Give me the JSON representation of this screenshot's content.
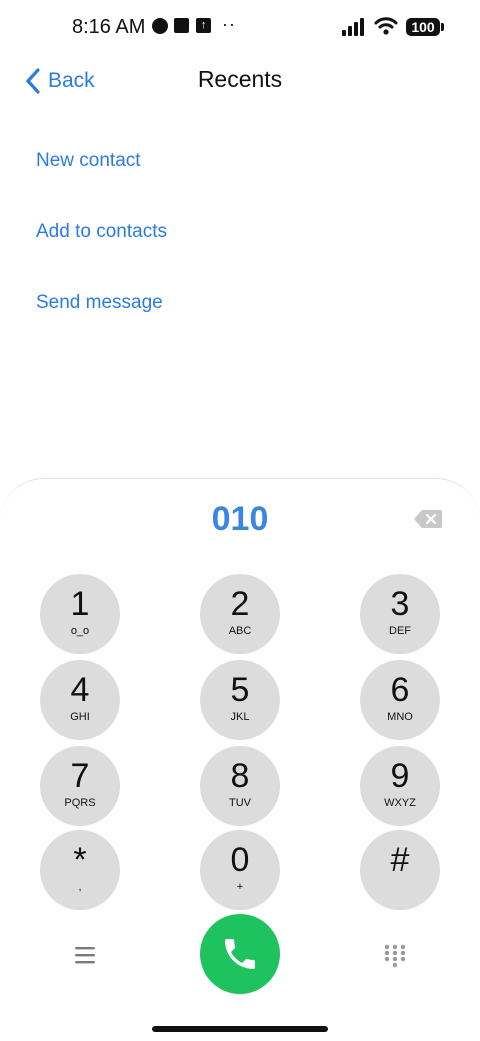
{
  "status_bar": {
    "time": "8:16 AM",
    "battery": "100",
    "icons": [
      "vpn-icon",
      "square-icon",
      "upload-icon",
      "more-dots-icon",
      "signal-icon",
      "wifi-icon",
      "battery-icon"
    ]
  },
  "header": {
    "back_label": "Back",
    "title": "Recents"
  },
  "actions": [
    {
      "label": "New contact"
    },
    {
      "label": "Add to contacts"
    },
    {
      "label": "Send message"
    }
  ],
  "dialer": {
    "number": "010",
    "keys": [
      {
        "digit": "1",
        "letters": "o_o"
      },
      {
        "digit": "2",
        "letters": "ABC"
      },
      {
        "digit": "3",
        "letters": "DEF"
      },
      {
        "digit": "4",
        "letters": "GHI"
      },
      {
        "digit": "5",
        "letters": "JKL"
      },
      {
        "digit": "6",
        "letters": "MNO"
      },
      {
        "digit": "7",
        "letters": "PQRS"
      },
      {
        "digit": "8",
        "letters": "TUV"
      },
      {
        "digit": "9",
        "letters": "WXYZ"
      },
      {
        "digit": "*",
        "letters": ","
      },
      {
        "digit": "0",
        "letters": "+"
      },
      {
        "digit": "#",
        "letters": ""
      }
    ]
  },
  "colors": {
    "accent": "#2c7be5",
    "number": "#3a86e0",
    "call_button": "#1ec25f",
    "key_background": "#dcdcdc"
  }
}
